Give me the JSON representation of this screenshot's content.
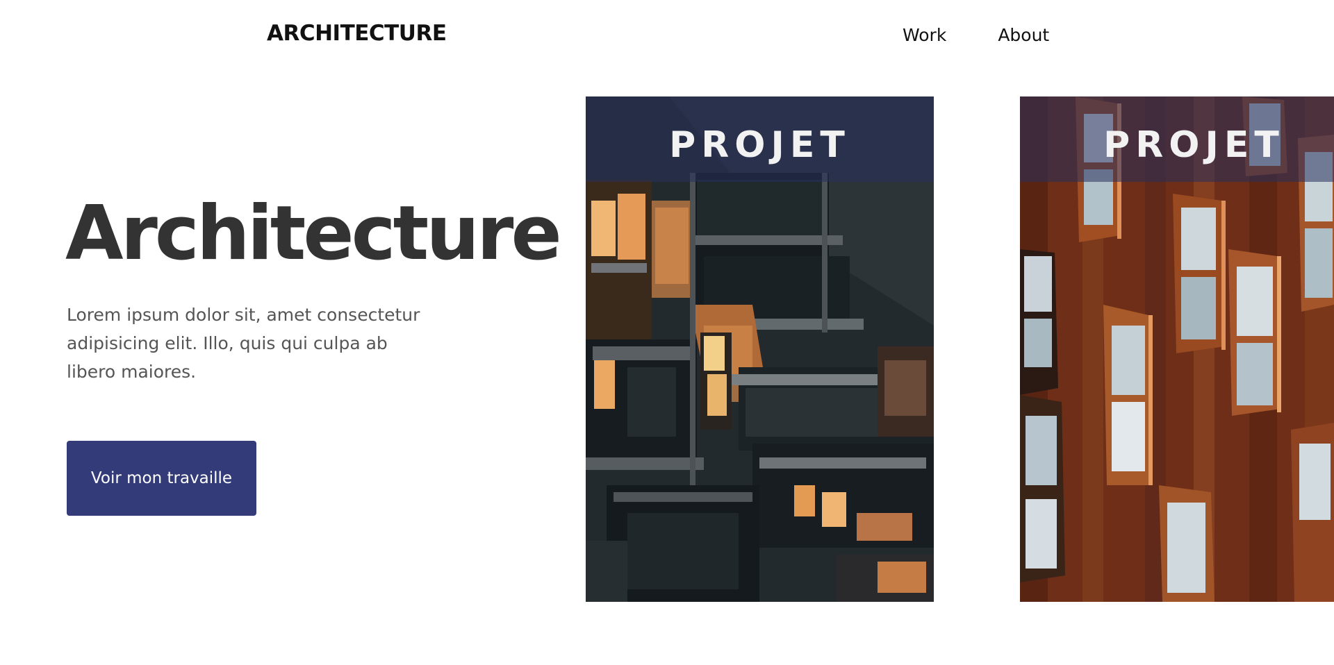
{
  "header": {
    "logo": "ARCHITECTURE",
    "nav": [
      {
        "label": "Work"
      },
      {
        "label": "About"
      }
    ]
  },
  "hero": {
    "title": "Architecture",
    "text": "Lorem ipsum dolor sit, amet consectetur adipisicing elit. Illo, quis qui culpa ab libero maiores.",
    "button_label": "Voir mon travaille"
  },
  "projects": [
    {
      "label": "PROJET"
    },
    {
      "label": "PROJET"
    }
  ],
  "colors": {
    "accent": "#343b79",
    "title": "#333333",
    "body_text": "#555555"
  }
}
